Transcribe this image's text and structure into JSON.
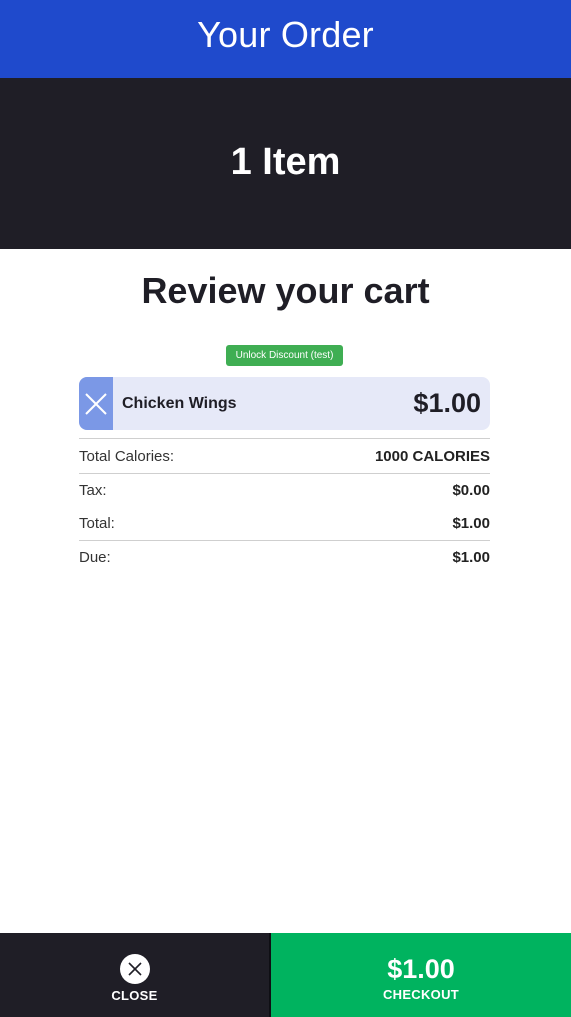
{
  "header": {
    "title": "Your Order"
  },
  "hero": {
    "item_count": "1 Item"
  },
  "review": {
    "title": "Review your cart",
    "discount_button": "Unlock Discount (test)"
  },
  "cart": {
    "items": [
      {
        "name": "Chicken Wings",
        "price": "$1.00",
        "remove_icon": "close-icon"
      }
    ]
  },
  "summary": {
    "calories_label": "Total Calories:",
    "calories_value": "1000 CALORIES",
    "tax_label": "Tax:",
    "tax_value": "$0.00",
    "total_label": "Total:",
    "total_value": "$1.00",
    "due_label": "Due:",
    "due_value": "$1.00"
  },
  "footer": {
    "close_label": "CLOSE",
    "close_icon": "close-circle-icon",
    "checkout_total": "$1.00",
    "checkout_label": "CHECKOUT"
  },
  "colors": {
    "header_bg": "#1f4acc",
    "hero_bg": "#1f1e26",
    "discount_green": "#3fae53",
    "checkout_green": "#00b35f",
    "item_bg": "#e6e9f8",
    "remove_bg": "#7b98e6"
  }
}
